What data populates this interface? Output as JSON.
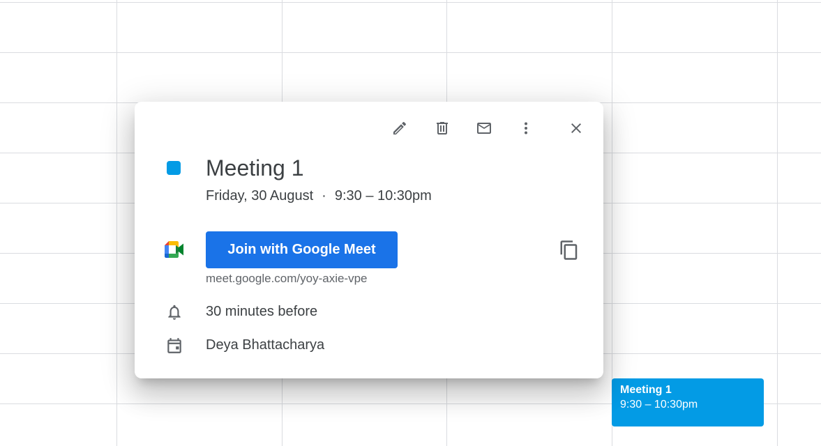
{
  "toolbar": {
    "edit_icon": "pencil-icon",
    "delete_icon": "trash-icon",
    "email_icon": "mail-icon",
    "more_icon": "more-vertical-icon",
    "close_icon": "close-icon"
  },
  "event": {
    "color": "#039be5",
    "title": "Meeting 1",
    "date": "Friday, 30 August",
    "separator": "·",
    "time": "9:30 – 10:30pm"
  },
  "meet": {
    "icon": "google-meet-logo",
    "join_label": "Join with Google Meet",
    "link": "meet.google.com/yoy-axie-vpe",
    "copy_icon": "copy-icon"
  },
  "reminder": {
    "icon": "bell-icon",
    "text": "30 minutes before"
  },
  "calendar": {
    "icon": "calendar-icon",
    "owner": "Deya Bhattacharya"
  },
  "event_chip": {
    "title": "Meeting 1",
    "time": "9:30 – 10:30pm",
    "color": "#039be5"
  },
  "colors": {
    "accent": "#1a73e8",
    "event_blue": "#039be5",
    "icon_grey": "#5f6368",
    "text": "#3c4043",
    "grid": "#dadce0"
  }
}
